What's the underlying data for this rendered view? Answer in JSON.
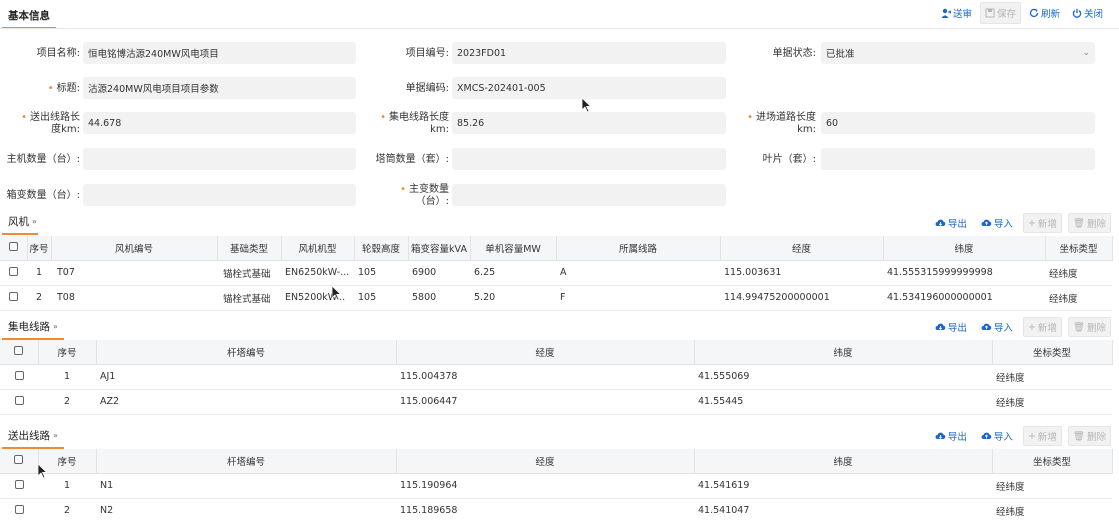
{
  "section_basic": "基本信息",
  "toolbar": {
    "send": "送审",
    "save": "保存",
    "refresh": "刷新",
    "close": "关闭"
  },
  "form": {
    "project_name_label": "项目名称:",
    "project_name": "恒电铭博沽源240MW风电项目",
    "project_code_label": "项目编号:",
    "project_code": "2023FD01",
    "status_label": "单据状态:",
    "status": "已批准",
    "title_label": "标题:",
    "title": "沽源240MW风电项目项目参数",
    "doc_code_label": "单据编码:",
    "doc_code": "XMCS-202401-005",
    "out_line_label_1": "送出线路长",
    "out_line_label_2": "度km:",
    "out_line": "44.678",
    "col_line_label_1": "集电线路长度",
    "col_line_label_2": "km:",
    "col_line": "85.26",
    "road_label_1": "进场道路长度",
    "road_label_2": "km:",
    "road": "60",
    "host_count_label": "主机数量（台）:",
    "host_count": "",
    "tower_count_label": "塔筒数量（套）:",
    "tower_count": "",
    "blade_label": "叶片（套）:",
    "blade": "",
    "box_count_label": "箱变数量（台）:",
    "box_count": "",
    "main_tr_label_1": "主变数量",
    "main_tr_label_2": "（台）:",
    "main_tr": ""
  },
  "actions": {
    "export": "导出",
    "import": "导入",
    "add": "新增",
    "delete": "删除"
  },
  "turbines": {
    "title": "风机",
    "headers": [
      "序号",
      "风机编号",
      "基础类型",
      "风机机型",
      "轮毂高度",
      "箱变容量kVA",
      "单机容量MW",
      "所属线路",
      "经度",
      "纬度",
      "坐标类型"
    ],
    "rows": [
      [
        "1",
        "T07",
        "锚栓式基础",
        "EN6250kW-...",
        "105",
        "6900",
        "6.25",
        "A",
        "115.003631",
        "41.555315999999998",
        "经纬度"
      ],
      [
        "2",
        "T08",
        "锚栓式基础",
        "EN5200kW...",
        "105",
        "5800",
        "5.20",
        "F",
        "114.99475200000001",
        "41.534196000000001",
        "经纬度"
      ]
    ]
  },
  "collector": {
    "title": "集电线路",
    "headers": [
      "序号",
      "杆塔编号",
      "经度",
      "纬度",
      "坐标类型"
    ],
    "rows": [
      [
        "1",
        "AJ1",
        "115.004378",
        "41.555069",
        "经纬度"
      ],
      [
        "2",
        "AZ2",
        "115.006447",
        "41.55445",
        "经纬度"
      ]
    ]
  },
  "outgoing": {
    "title": "送出线路",
    "headers": [
      "序号",
      "杆塔编号",
      "经度",
      "纬度",
      "坐标类型"
    ],
    "rows": [
      [
        "1",
        "N1",
        "115.190964",
        "41.541619",
        "经纬度"
      ],
      [
        "2",
        "N2",
        "115.189658",
        "41.541047",
        "经纬度"
      ]
    ]
  }
}
